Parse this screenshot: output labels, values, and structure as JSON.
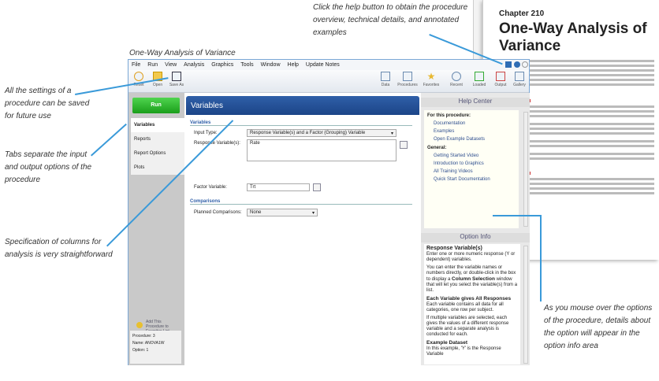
{
  "annotations": {
    "help": "Click the help button to obtain the procedure overview, technical details, and annotated examples",
    "window_title": "One-Way Analysis of Variance",
    "save": "All the settings of a procedure can be saved for future use",
    "tabs": "Tabs separate the input and output options of the procedure",
    "columns": "Specification of columns for analysis is very straightforward",
    "option_info": "As you mouse over the options of the procedure, details about the option will appear in the option info area"
  },
  "doc": {
    "chapter": "Chapter 210",
    "title": "One-Way Analysis of Variance"
  },
  "menu": [
    "File",
    "Run",
    "View",
    "Analysis",
    "Graphics",
    "Tools",
    "Window",
    "Help",
    "Update Notes"
  ],
  "toolbar_left": [
    "Reset",
    "Open",
    "Save As"
  ],
  "toolbar_right": [
    "Data",
    "Procedures",
    "Favorites",
    "Recent",
    "Loaded",
    "Output",
    "Gallery"
  ],
  "left": {
    "run": "Run",
    "tabs": [
      "Variables",
      "Reports",
      "Report Options",
      "Plots"
    ],
    "favorites": "Add This Procedure to Favorites List",
    "status": [
      "Procedure: 3",
      "Name: ANOVA1W",
      "Option: 1"
    ]
  },
  "main": {
    "header": "Variables",
    "section1": "Variables",
    "input_type_label": "Input Type:",
    "input_type_value": "Response Variable(s) and a Factor (Grouping) Variable",
    "response_label": "Response Variable(s):",
    "response_value": "Rate",
    "factor_label": "Factor Variable:",
    "factor_value": "Trt",
    "section2": "Comparisons",
    "planned_label": "Planned Comparisons:",
    "planned_value": "None"
  },
  "help": {
    "title": "Help Center",
    "for_this": "For this procedure:",
    "proc_links": [
      "Documentation",
      "Examples",
      "Open Example Datasets"
    ],
    "general": "General:",
    "general_links": [
      "Getting Started Video",
      "Introduction to Graphics",
      "All Training Videos",
      "Quick Start Documentation"
    ]
  },
  "option_info": {
    "title": "Option Info",
    "heading": "Response Variable(s)",
    "p1": "Enter one or more numeric response (Y or dependent) variables.",
    "p2a": "You can enter the variable names or numbers directly, or double-click in the box to display a ",
    "p2b": "Column Selection",
    "p2c": " window that will let you select the variable(s) from a list.",
    "h2": "Each Variable gives All Responses",
    "p3": "Each variable contains all data for all categories, one row per subject.",
    "p4": "If multiple variables are selected, each gives the values of a different response variable and a separate analysis is conducted for each.",
    "h3": "Example Dataset",
    "p5": "In this example, 'Y' is the Response Variable"
  }
}
